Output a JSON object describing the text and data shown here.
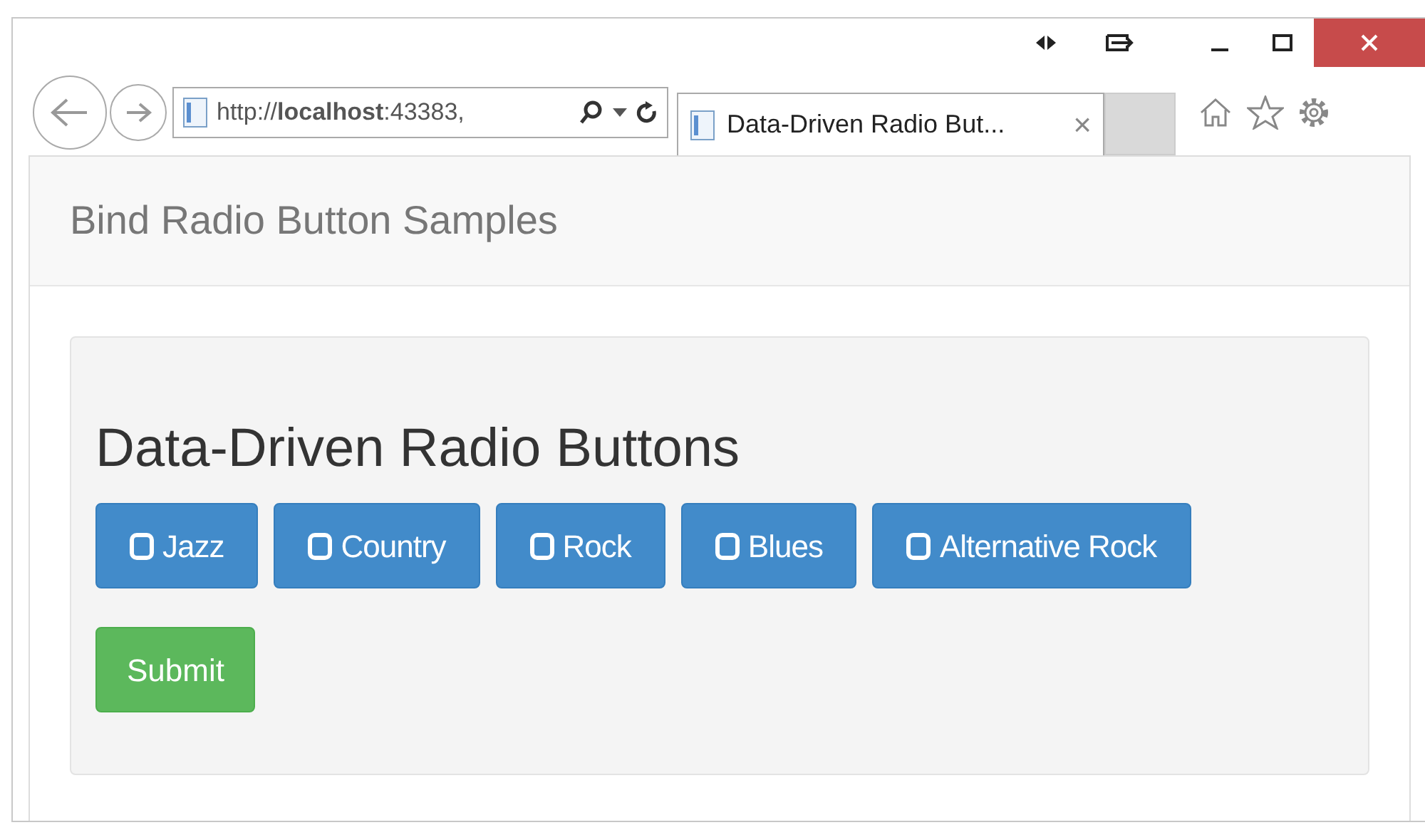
{
  "browser": {
    "address": "http://**localhost**:43383,",
    "tabs": [
      {
        "label": "Data-Driven Radio But...",
        "selected": true
      }
    ],
    "close_tab": "×"
  },
  "navbar": {
    "brand": "Bind Radio Button Samples"
  },
  "panel": {
    "heading": "Data-Driven Radio Buttons",
    "options": [
      {
        "label": "Jazz",
        "checked": false
      },
      {
        "label": "Country",
        "checked": false
      },
      {
        "label": "Rock",
        "checked": false
      },
      {
        "label": "Blues",
        "checked": false
      },
      {
        "label": "Alternative Rock",
        "checked": false
      }
    ],
    "submit": "Submit"
  }
}
